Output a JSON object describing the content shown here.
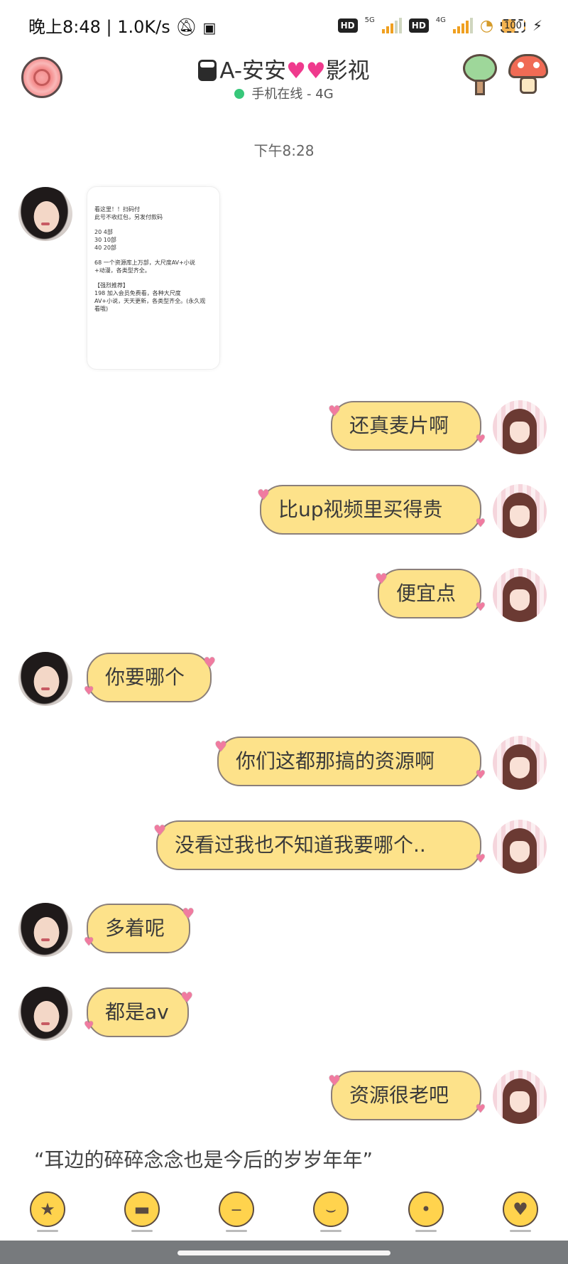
{
  "status_bar": {
    "time": "晚上8:48",
    "speed": "1.0K/s",
    "hd": "HD",
    "net1": "5G",
    "net2": "4G",
    "battery": "100"
  },
  "header": {
    "title_prefix": "A-安安",
    "title_suffix": "影视",
    "status": "手机在线 - 4G"
  },
  "timestamp": "下午8:28",
  "screenshot_card": {
    "lines": [
      "看这里！！扫码付",
      "此号不收红包，另发付款码",
      "",
      "20 4部",
      "30 10部",
      "40 20部",
      "",
      "68 一个资源库上万部，大尺度AV+小说",
      "+动漫，各类型齐全。",
      "",
      "【强烈推荐】",
      "198 加入会员免费看，各种大尺度",
      "AV+小说，天天更新，各类型齐全。(永久观",
      "看哦)"
    ]
  },
  "messages": [
    {
      "side": "right",
      "text": "还真麦片啊"
    },
    {
      "side": "right",
      "text": "比up视频里买得贵"
    },
    {
      "side": "right",
      "text": "便宜点"
    },
    {
      "side": "left",
      "text": "你要哪个"
    },
    {
      "side": "right",
      "text": "你们这都那搞的资源啊"
    },
    {
      "side": "right",
      "text": "没看过我也不知道我要哪个.."
    },
    {
      "side": "left",
      "text": "多着呢"
    },
    {
      "side": "left",
      "text": "都是av"
    },
    {
      "side": "right",
      "text": "资源很老吧"
    }
  ],
  "signature": "“耳边的碎碎念念也是今后的岁岁年年”",
  "emoji_bar": [
    "grin-stars-emoji",
    "sunglasses-emoji",
    "headband-emoji",
    "laughing-emoji",
    "tongue-emoji",
    "heart-eyes-emoji"
  ],
  "colors": {
    "bubble": "#fde28a",
    "bubble_border": "#8b7f7a",
    "heart": "#f07ba0",
    "online_dot": "#37c77a"
  }
}
